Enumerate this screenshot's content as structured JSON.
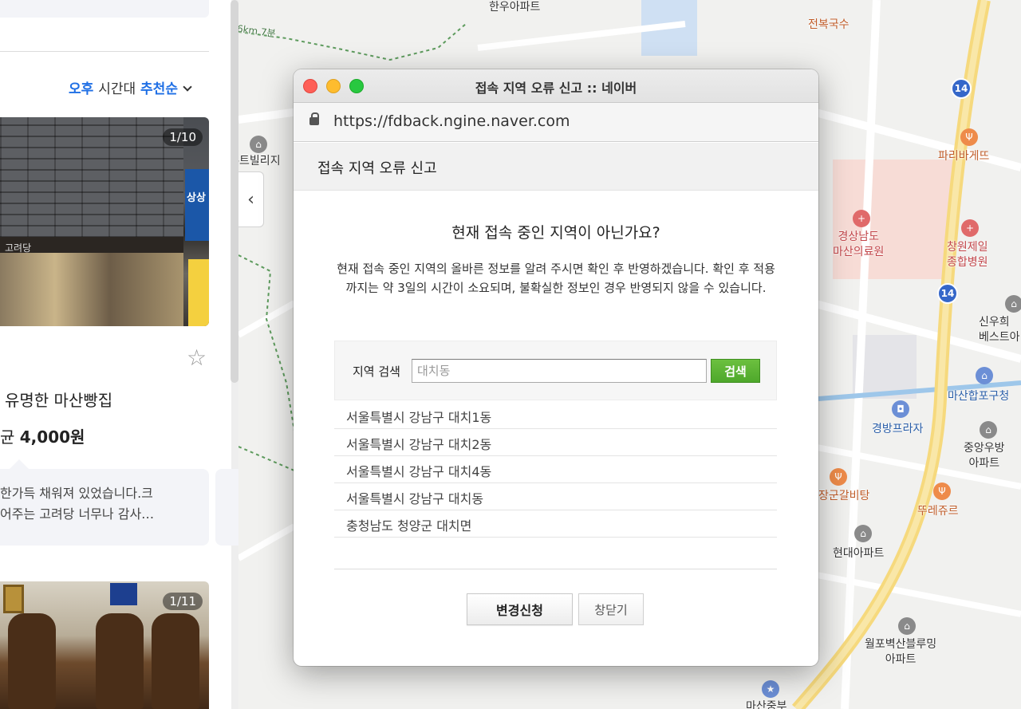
{
  "left_panel": {
    "sort": {
      "time_value": "오후",
      "time_label": "시간대",
      "sort_value": "추천순"
    },
    "place1": {
      "photo_counter": "1/10",
      "name": "유명한 마산빵집",
      "price_prefix": "균",
      "price_value": "4,000원",
      "review_line1": "한가득 채워져 있었습니다.크",
      "review_line2": "어주는 고려당 너무나 감사…"
    },
    "place2": {
      "photo_counter": "1/11"
    }
  },
  "map": {
    "labels": {
      "hanwoo_apt": "한우아파트",
      "jeonbok": "전복국수",
      "walk": "6km 7분",
      "villa": "-트빌리지",
      "paris": "파리바게뜨",
      "gyeongnam_hospital": "경상남도\n마산의료원",
      "changwon_hospital": "창원제일\n종합병원",
      "shinwoo": "신우희\n베스트아",
      "masan_post": "마산합포구청",
      "gyeongbang": "경방프라자",
      "jungang_apt": "중앙우방\n아파트",
      "galbi": "장군갈비탕",
      "tture": "뚜레쥬르",
      "hyundai_apt": "현대아파트",
      "wolpo_apt": "월포벽산블루밍\n아파트",
      "masan_station": "마산중부"
    },
    "road_number": "14"
  },
  "popup": {
    "window_title": "접속 지역 오류 신고 :: 네이버",
    "url": "https://fdback.ngine.naver.com",
    "header_title": "접속 지역 오류 신고",
    "question": "현재 접속 중인 지역이 아닌가요?",
    "description": "현재 접속 중인 지역의 올바른 정보를 알려 주시면 확인 후 반영하겠습니다. 확인 후 적용까지는 약 3일의 시간이 소요되며, 불확실한 정보인 경우 반영되지 않을 수 있습니다.",
    "search_label": "지역 검색",
    "search_placeholder": "대치동",
    "search_button": "검색",
    "results": [
      "서울특별시 강남구 대치1동",
      "서울특별시 강남구 대치2동",
      "서울특별시 강남구 대치4동",
      "서울특별시 강남구 대치동",
      "충청남도 청양군 대치면"
    ],
    "apply_button": "변경신청",
    "close_button": "창닫기"
  }
}
